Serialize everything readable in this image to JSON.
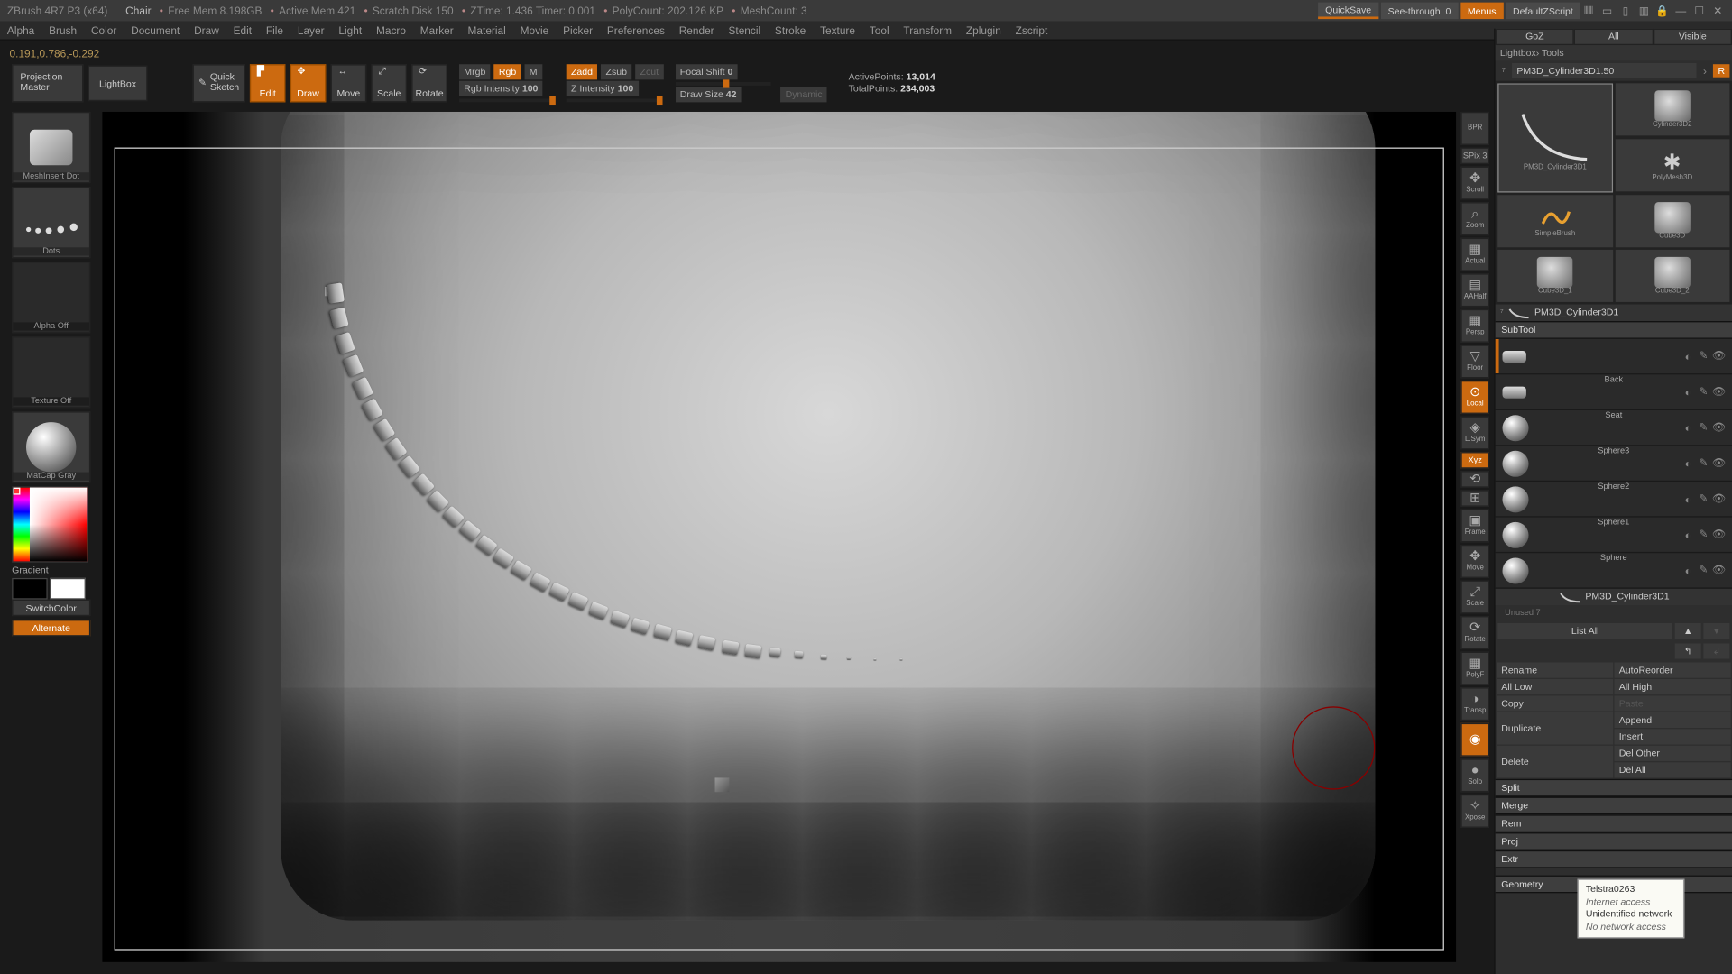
{
  "title": {
    "app": "ZBrush 4R7 P3 (x64)",
    "project": "Chair",
    "freemem": "Free Mem 8.198GB",
    "activemem": "Active Mem 421",
    "scratch": "Scratch Disk 150",
    "ztime": "ZTime: 1.436 Timer: 0.001",
    "polycount": "PolyCount: 202.126 KP",
    "meshcount": "MeshCount: 3",
    "quicksave": "QuickSave",
    "seethrough": "See-through",
    "seethrough_val": "0",
    "menus": "Menus",
    "zscript": "DefaultZScript"
  },
  "menu": [
    "Alpha",
    "Brush",
    "Color",
    "Document",
    "Draw",
    "Edit",
    "File",
    "Layer",
    "Light",
    "Macro",
    "Marker",
    "Material",
    "Movie",
    "Picker",
    "Preferences",
    "Render",
    "Stencil",
    "Stroke",
    "Texture",
    "Tool",
    "Transform",
    "Zplugin",
    "Zscript"
  ],
  "status_coords": "0.191,0.786,-0.292",
  "shelf": {
    "projection": "Projection Master",
    "lightbox": "LightBox",
    "quicksketch": "Quick Sketch",
    "edit": "Edit",
    "draw": "Draw",
    "move": "Move",
    "scale": "Scale",
    "rotate": "Rotate",
    "mrgb": "Mrgb",
    "rgb": "Rgb",
    "m": "M",
    "rgb_int_lbl": "Rgb Intensity",
    "rgb_int_val": "100",
    "zadd": "Zadd",
    "zsub": "Zsub",
    "zcut": "Zcut",
    "zint_lbl": "Z Intensity",
    "zint_val": "100",
    "focal_lbl": "Focal Shift",
    "focal_val": "0",
    "drawsize_lbl": "Draw Size",
    "drawsize_val": "42",
    "dynamic": "Dynamic",
    "active_lbl": "ActivePoints:",
    "active_val": "13,014",
    "total_lbl": "TotalPoints:",
    "total_val": "234,003"
  },
  "left": {
    "brush_name": "MeshInsert Dot",
    "stroke_name": "Dots",
    "alpha_name": "Alpha Off",
    "texture_name": "Texture Off",
    "material_name": "MatCap Gray",
    "gradient": "Gradient",
    "switchcolor": "SwitchColor",
    "alternate": "Alternate"
  },
  "rtools": [
    {
      "lbl": "BPR"
    },
    {
      "lbl": "SPix",
      "val": "3",
      "thin": true
    },
    {
      "lbl": "Scroll",
      "ic": "✥"
    },
    {
      "lbl": "Zoom",
      "ic": "⌕"
    },
    {
      "lbl": "Actual",
      "ic": "▦"
    },
    {
      "lbl": "AAHalf",
      "ic": "▤"
    },
    {
      "lbl": "Persp",
      "ic": "▦"
    },
    {
      "lbl": "Floor",
      "ic": "▽"
    },
    {
      "lbl": "Local",
      "ic": "⊙",
      "on": true
    },
    {
      "lbl": "L.Sym",
      "ic": "◈"
    },
    {
      "lbl": "Xyz",
      "thin": true,
      "on": true
    },
    {
      "lbl": "",
      "ic": "⟲",
      "thin": true
    },
    {
      "lbl": "",
      "ic": "⊞",
      "thin": true
    },
    {
      "lbl": "Frame",
      "ic": "▣"
    },
    {
      "lbl": "Move",
      "ic": "✥"
    },
    {
      "lbl": "Scale",
      "ic": "⤢"
    },
    {
      "lbl": "Rotate",
      "ic": "⟳"
    },
    {
      "lbl": "PolyF",
      "ic": "▦"
    },
    {
      "lbl": "Transp",
      "ic": "◑"
    },
    {
      "lbl": "",
      "ic": "◉",
      "on": true,
      "noLabel": true
    },
    {
      "lbl": "Solo",
      "ic": "●"
    },
    {
      "lbl": "Xpose",
      "ic": "✧"
    }
  ],
  "rpanel": {
    "tabs": [
      "GoZ",
      "All",
      "Visible"
    ],
    "crumb": "Lightbox› Tools",
    "toolname": "PM3D_Cylinder3D1.50",
    "r": "R",
    "tools": [
      "PM3D_Cylinder3D1",
      "Cylinder3D2",
      "PolyMesh3D",
      "SimpleBrush",
      "Cube3D",
      "Cube3D_1",
      "Cube3D_2"
    ],
    "toolrow": "PM3D_Cylinder3D1",
    "subtool_head": "SubTool",
    "subtools": [
      {
        "name": "",
        "active": true,
        "flat": true
      },
      {
        "name": "Back",
        "flat": true
      },
      {
        "name": "Seat"
      },
      {
        "name": "Sphere3"
      },
      {
        "name": "Sphere2"
      },
      {
        "name": "Sphere1"
      },
      {
        "name": "Sphere"
      }
    ],
    "subrow2": "PM3D_Cylinder3D1",
    "unused": "Unused 7",
    "listall": "List All",
    "btns": {
      "rename": "Rename",
      "autoreorder": "AutoReorder",
      "alllow": "All Low",
      "allhigh": "All High",
      "copy": "Copy",
      "paste": "Paste",
      "duplicate": "Duplicate",
      "append": "Append",
      "insert": "Insert",
      "delete": "Delete",
      "delother": "Del Other",
      "delall": "Del All",
      "split": "Split",
      "merge": "Merge",
      "remesh": "Rem",
      "project": "Proj",
      "extract": "Extr",
      "geometry": "Geometry"
    }
  },
  "tooltip": {
    "l1": "Telstra0263",
    "l2": "Internet access",
    "l3": "Unidentified network",
    "l4": "No network access"
  }
}
